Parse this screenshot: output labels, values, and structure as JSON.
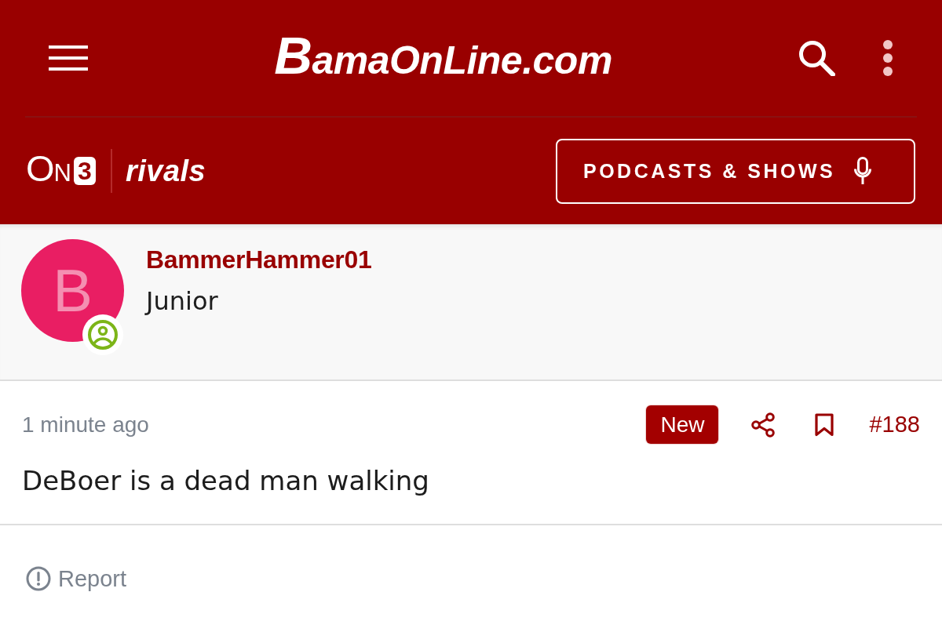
{
  "header": {
    "logo": "BamaOnLine.com",
    "partner_logo": {
      "text": "ON",
      "badge": "3"
    },
    "network_logo": "rivals",
    "podcasts_button": "PODCASTS & SHOWS"
  },
  "author": {
    "avatar_letter": "B",
    "username": "BammerHammer01",
    "rank": "Junior"
  },
  "post": {
    "time": "1 minute ago",
    "badge": "New",
    "number": "#188",
    "body": "DeBoer is a dead man walking"
  },
  "actions": [
    {
      "label": "Report"
    }
  ]
}
